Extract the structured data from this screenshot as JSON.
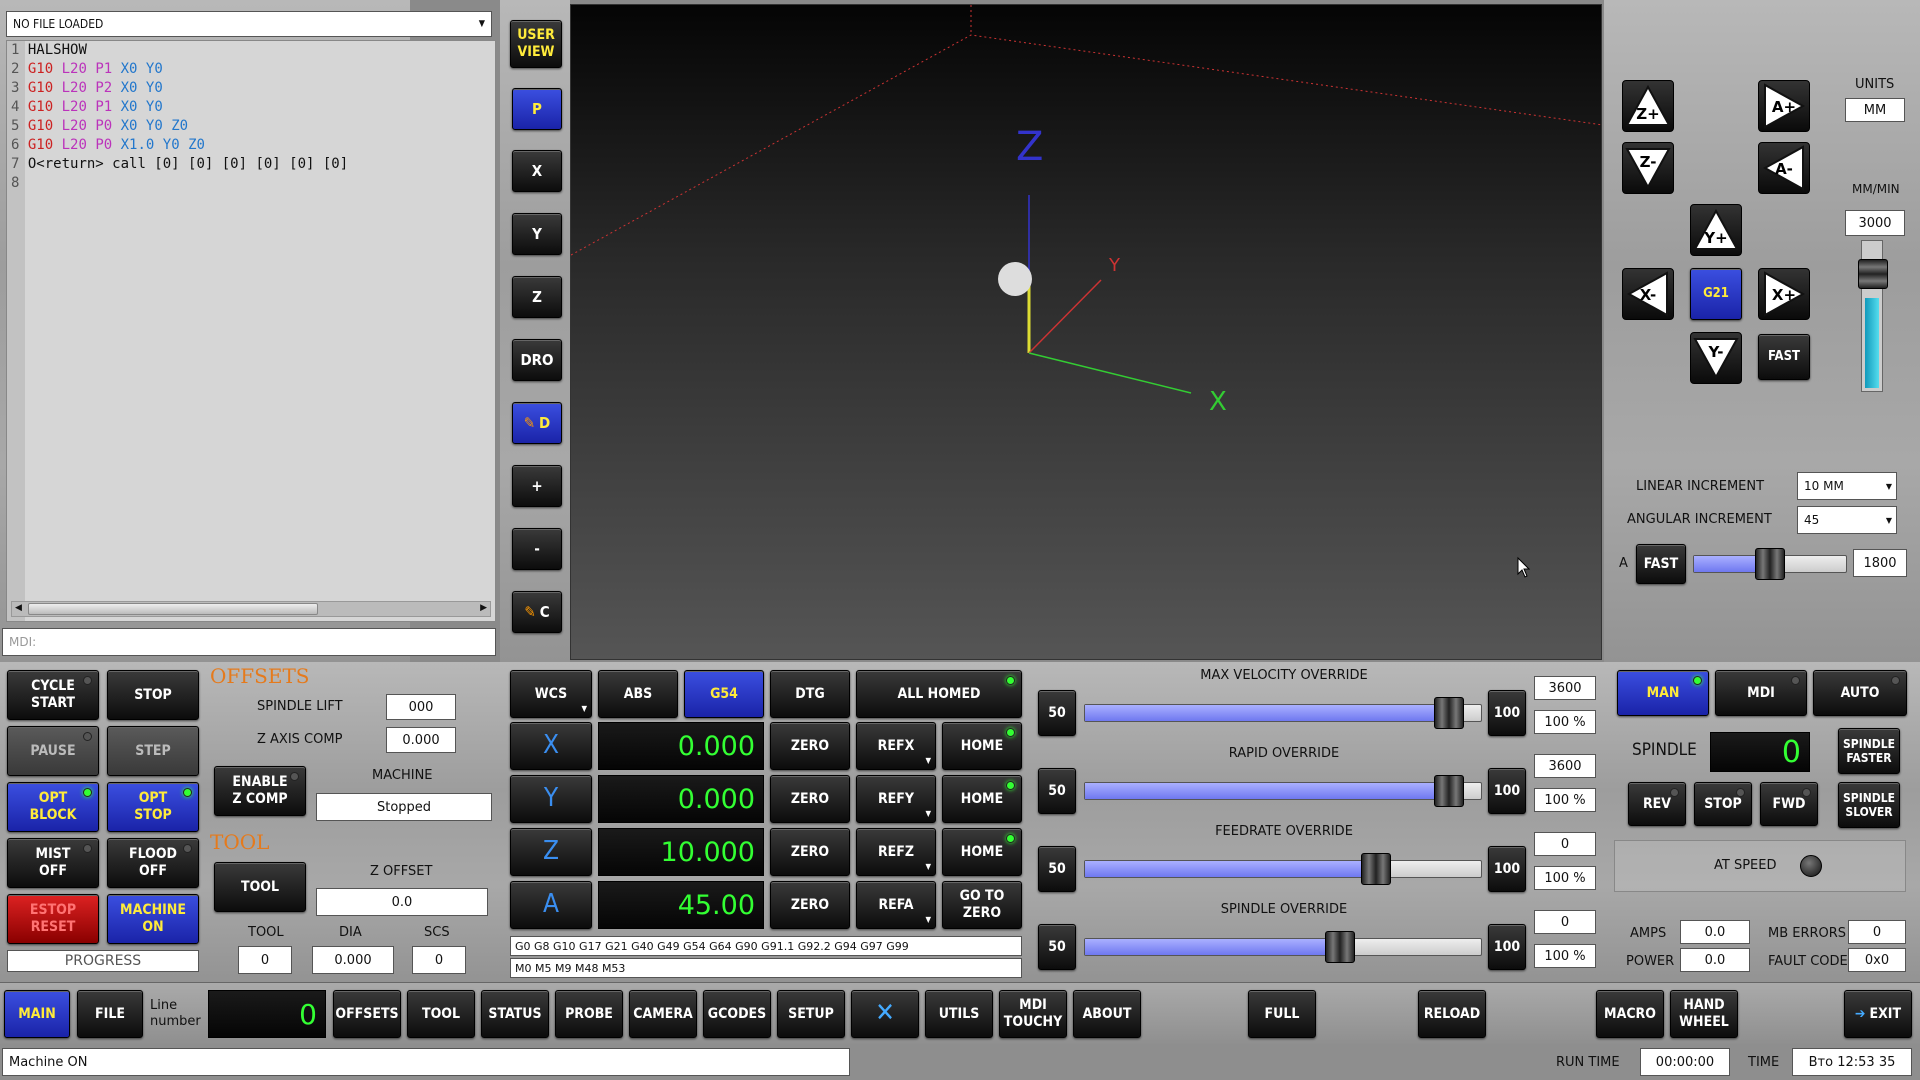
{
  "file": {
    "combo": "NO FILE LOADED",
    "lines": [
      {
        "n": "1",
        "t": [
          [
            "HALSHOW",
            "#111"
          ]
        ]
      },
      {
        "n": "2",
        "t": [
          [
            "G10",
            "#c22"
          ],
          [
            " L20",
            "#b3b"
          ],
          [
            " P1",
            "#b3b"
          ],
          [
            " X0",
            "#27c"
          ],
          [
            " Y0",
            "#27c"
          ]
        ]
      },
      {
        "n": "3",
        "t": [
          [
            "G10",
            "#c22"
          ],
          [
            " L20",
            "#b3b"
          ],
          [
            " P2",
            "#b3b"
          ],
          [
            " X0",
            "#27c"
          ],
          [
            " Y0",
            "#27c"
          ]
        ]
      },
      {
        "n": "4",
        "t": [
          [
            "G10",
            "#c22"
          ],
          [
            " L20",
            "#b3b"
          ],
          [
            " P1",
            "#b3b"
          ],
          [
            " X0",
            "#27c"
          ],
          [
            " Y0",
            "#27c"
          ]
        ]
      },
      {
        "n": "5",
        "t": [
          [
            "G10",
            "#c22"
          ],
          [
            " L20",
            "#b3b"
          ],
          [
            " P0",
            "#b3b"
          ],
          [
            " X0",
            "#27c"
          ],
          [
            " Y0",
            "#27c"
          ],
          [
            " Z0",
            "#27c"
          ]
        ]
      },
      {
        "n": "6",
        "t": [
          [
            "G10",
            "#c22"
          ],
          [
            " L20",
            "#b3b"
          ],
          [
            " P0",
            "#b3b"
          ],
          [
            " X1.0",
            "#27c"
          ],
          [
            " Y0",
            "#27c"
          ],
          [
            " Z0",
            "#27c"
          ]
        ]
      },
      {
        "n": "7",
        "t": [
          [
            "O<return> call [0] [0] [0] [0] [0] [0]",
            "#111"
          ]
        ]
      },
      {
        "n": "8",
        "t": []
      }
    ]
  },
  "mdi": {
    "placeholder": "MDI:"
  },
  "view": {
    "user_view": "USER\nVIEW",
    "p": "P",
    "x": "X",
    "y": "Y",
    "z": "Z",
    "dro": "DRO",
    "d": "D",
    "plus": "+",
    "minus": "-",
    "c": "C",
    "axis_z": "Z",
    "axis_y": "Y",
    "axis_x": "X"
  },
  "jog": {
    "units_label": "UNITS",
    "units_value": "MM",
    "rate_label": "MM/MIN",
    "rate_value": "3000",
    "g21": "G21",
    "fast": "FAST",
    "linear_label": "LINEAR INCREMENT",
    "linear_value": "10 MM",
    "angular_label": "ANGULAR INCREMENT",
    "angular_value": "45",
    "a_label": "A",
    "a_fast": "FAST",
    "a_rate": "1800",
    "jog_fraction": 0.6,
    "a_fraction": 0.5
  },
  "program": {
    "cycle_start": "CYCLE\nSTART",
    "stop": "STOP",
    "pause": "PAUSE",
    "step": "STEP",
    "opt_block": "OPT\nBLOCK",
    "opt_stop": "OPT\nSTOP",
    "mist": "MIST\nOFF",
    "flood": "FLOOD\nOFF",
    "estop": "ESTOP\nRESET",
    "machine_on": "MACHINE\nON",
    "progress": "PROGRESS"
  },
  "offsets": {
    "title": "OFFSETS",
    "spindle_lift_label": "SPINDLE LIFT",
    "spindle_lift": "000",
    "zcomp_label": "Z AXIS COMP",
    "zcomp": "0.000",
    "enable_zcomp": "ENABLE\nZ COMP",
    "machine_label": "MACHINE",
    "machine_state": "Stopped",
    "tool_title": "TOOL",
    "tool_btn": "TOOL",
    "zoffset_label": "Z OFFSET",
    "zoffset": "0.0",
    "tool_label": "TOOL",
    "tool": "0",
    "dia_label": "DIA",
    "dia": "0.000",
    "scs_label": "SCS",
    "scs": "0"
  },
  "dro": {
    "wcs": "WCS",
    "abs": "ABS",
    "g54": "G54",
    "dtg": "DTG",
    "all_homed": "ALL HOMED",
    "axes": [
      {
        "axis": "X",
        "value": "0.000",
        "zero": "ZERO",
        "ref": "REFX",
        "home": "HOME"
      },
      {
        "axis": "Y",
        "value": "0.000",
        "zero": "ZERO",
        "ref": "REFY",
        "home": "HOME"
      },
      {
        "axis": "Z",
        "value": "10.000",
        "zero": "ZERO",
        "ref": "REFZ",
        "home": "HOME"
      },
      {
        "axis": "A",
        "value": "45.00",
        "zero": "ZERO",
        "ref": "REFA",
        "home": "GO TO\nZERO"
      }
    ],
    "gcodes": "G0 G8 G10 G17 G21 G40 G49 G54 G64 G90 G91.1 G92.2 G94 G97 G99",
    "mcodes": "M0 M5 M9 M48 M53"
  },
  "overrides": [
    {
      "title": "MAX VELOCITY OVERRIDE",
      "low": "50",
      "high": "100",
      "value": "3600",
      "percent": "100 %",
      "fraction": 1.0
    },
    {
      "title": "RAPID OVERRIDE",
      "low": "50",
      "high": "100",
      "value": "3600",
      "percent": "100 %",
      "fraction": 1.0
    },
    {
      "title": "FEEDRATE OVERRIDE",
      "low": "50",
      "high": "100",
      "value": "0",
      "percent": "100 %",
      "fraction": 0.8
    },
    {
      "title": "SPINDLE OVERRIDE",
      "low": "50",
      "high": "100",
      "value": "0",
      "percent": "100 %",
      "fraction": 0.7
    }
  ],
  "mode": {
    "man": "MAN",
    "mdi": "MDI",
    "auto": "AUTO"
  },
  "spindle": {
    "label": "SPINDLE",
    "rpm": "0",
    "faster": "SPINDLE\nFASTER",
    "slower": "SPINDLE\nSLOVER",
    "rev": "REV",
    "stop": "STOP",
    "fwd": "FWD",
    "at_speed": "AT SPEED",
    "amps_label": "AMPS",
    "amps": "0.0",
    "mb_label": "MB ERRORS",
    "mb": "0",
    "power_label": "POWER",
    "power": "0.0",
    "fault_label": "FAULT CODE",
    "fault": "0x0"
  },
  "nav": {
    "main": "MAIN",
    "file": "FILE",
    "line_label": "Line\nnumber",
    "line_value": "0",
    "offsets": "OFFSETS",
    "tool": "TOOL",
    "status": "STATUS",
    "probe": "PROBE",
    "camera": "CAMERA",
    "gcodes": "GCODES",
    "setup": "SETUP",
    "utils": "UTILS",
    "mdi_touchy": "MDI\nTOUCHY",
    "about": "ABOUT",
    "full": "FULL",
    "reload": "RELOAD",
    "macro": "MACRO",
    "hand_wheel": "HAND\nWHEEL",
    "exit": "EXIT"
  },
  "status": {
    "message": "Machine ON",
    "run_time_label": "RUN TIME",
    "run_time": "00:00:00",
    "time_label": "TIME",
    "time": "Вто 12:53 35"
  }
}
